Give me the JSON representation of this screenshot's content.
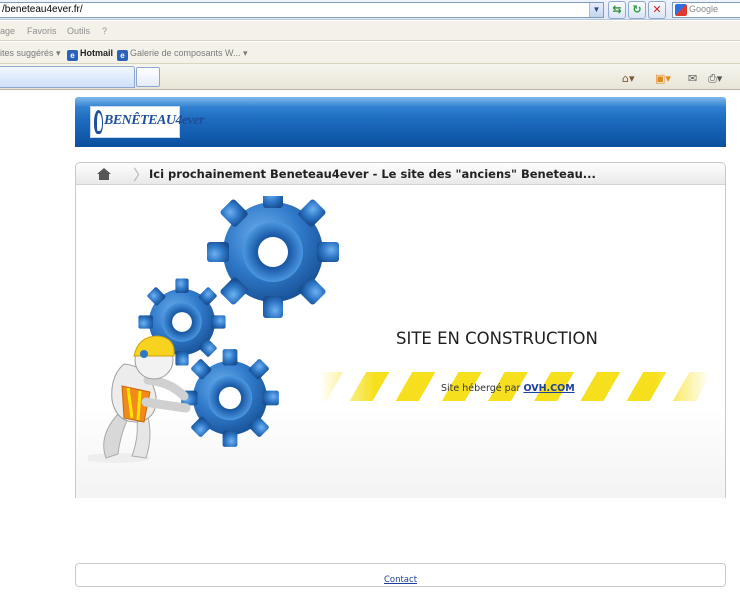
{
  "browser": {
    "address_url": "/beneteau4ever.fr/",
    "search_placeholder": "Google",
    "menu": [
      "age",
      "Favoris",
      "Outils",
      "?"
    ],
    "favorites": [
      {
        "label": "ites suggérés ▾"
      },
      {
        "label": "Hotmail"
      },
      {
        "label": "Galerie de composants W... ▾"
      }
    ]
  },
  "page": {
    "logo_text": "BENÊTEAU4ever",
    "breadcrumb_title": "Ici prochainement Beneteau4ever - Le site des \"anciens\" Beneteau...",
    "construction_title": "SITE EN CONSTRUCTION",
    "hosted_prefix": "Site hébergé par",
    "hosted_link": "OVH.COM",
    "footer_link": "Contact"
  },
  "colors": {
    "banner": "#1d6cc0",
    "stripe_yellow": "#f6e01e",
    "gear_blue": "#2f78c8",
    "link": "#1d3f9c"
  }
}
